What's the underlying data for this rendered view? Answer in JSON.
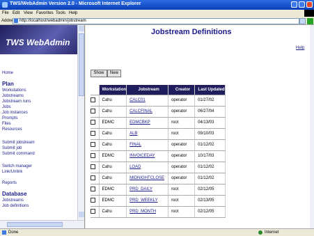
{
  "window": {
    "title": "TWS/WebAdmin Version 2.0 - Microsoft Internet Explorer"
  },
  "menu": [
    "File",
    "Edit",
    "View",
    "Favorites",
    "Tools",
    "Help"
  ],
  "address": {
    "label": "Address",
    "value": "http://localhost/webadmin/jobstream"
  },
  "sidebar": {
    "logo_text": "TWS WebAdmin",
    "top_link": "Home",
    "plan_heading": "Plan",
    "plan_items": [
      "Workstations",
      "Jobstreams",
      "Jobstream runs",
      "Jobs",
      "Job instances",
      "Prompts",
      "Files",
      "Resources"
    ],
    "group2": [
      "Submit jobstream",
      "Submit job",
      "Submit command"
    ],
    "group3": [
      "Switch manager",
      "Link/Unlink"
    ],
    "group4": "Reports",
    "db_heading": "Database",
    "db_items": [
      "Jobstreams",
      "Job definitions"
    ]
  },
  "main": {
    "title": "Jobstream Definitions",
    "help": "Help",
    "show_button": "Show",
    "new_button": "New",
    "columns": [
      "Workstation",
      "Jobstream",
      "Creator",
      "Last Updated"
    ],
    "rows": [
      [
        "Cahu",
        "CALC01",
        "operator",
        "01/27/02"
      ],
      [
        "Cahu",
        "CALCFINAL",
        "operator",
        "06/27/04"
      ],
      [
        "EDMC",
        "EDMCBKP",
        "root",
        "04/13/03"
      ],
      [
        "Cahu",
        "ALB",
        "root",
        "09/10/03"
      ],
      [
        "Cahu",
        "FINAL",
        "operator",
        "01/12/02"
      ],
      [
        "EDMC",
        "INVOICEDAY",
        "operator",
        "10/17/03"
      ],
      [
        "Cahu",
        "LOAD",
        "operator",
        "01/12/02"
      ],
      [
        "Cahu",
        "MIDNIGHTCLOSE",
        "operator",
        "01/12/02"
      ],
      [
        "EDMC",
        "PRD_DAILY",
        "root",
        "02/12/05"
      ],
      [
        "EDMC",
        "PRD_WEEKLY",
        "root",
        "02/13/05"
      ],
      [
        "Cahu",
        "PRD_MONTH",
        "root",
        "02/12/05"
      ]
    ]
  },
  "status": {
    "text": "Done",
    "zone": "Internet"
  }
}
